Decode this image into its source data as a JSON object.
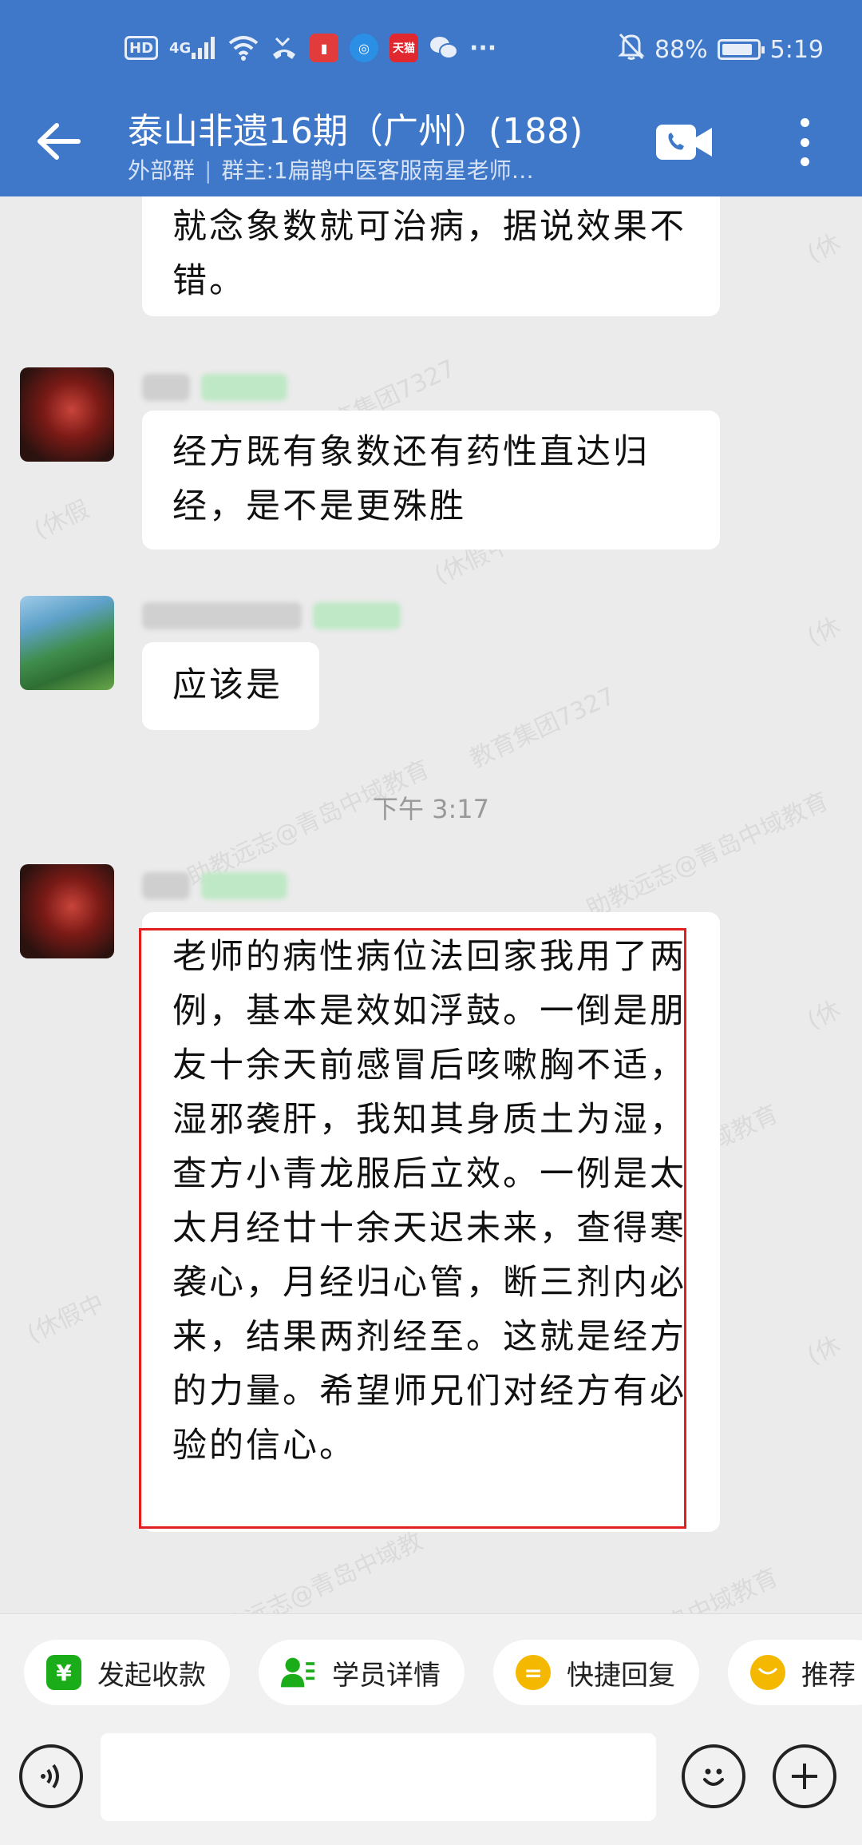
{
  "status_bar": {
    "network_label": "HD",
    "signal_label": "4G",
    "battery_percent": "88%",
    "battery_level": 0.88,
    "time": "5:19",
    "more_dots": "···"
  },
  "header": {
    "title": "泰山非遗16期（广州）(188)",
    "group_type": "外部群",
    "owner": "群主:1扁鹊中医客服南星老师…"
  },
  "messages": [
    {
      "text": "就念象数就可治病，据说效果不错。"
    },
    {
      "text": "经方既有象数还有药性直达归经，是不是更殊胜"
    },
    {
      "text": "应该是"
    },
    {
      "text": "老师的病性病位法回家我用了两例，基本是效如浮鼓。一倒是朋友十余天前感冒后咳嗽胸不适，湿邪袭肝，我知其身质土为湿，查方小青龙服后立效。一例是太太月经廿十余天迟未来，查得寒袭心，月经归心管，断三剂内必来，结果两剂经至。这就是经方的力量。希望师兄们对经方有必验的信心。"
    }
  ],
  "time_divider": "下午 3:17",
  "quick_actions": [
    {
      "label": "发起收款",
      "icon": "¥",
      "color": "#1aad19"
    },
    {
      "label": "学员详情",
      "icon": "person",
      "color": "#1aad19"
    },
    {
      "label": "快捷回复",
      "icon": "=",
      "color": "#f5b800"
    },
    {
      "label": "推荐",
      "icon": "smile",
      "color": "#f5b800"
    }
  ],
  "input": {
    "value": "",
    "placeholder": ""
  },
  "colors": {
    "header_bg": "#3f78c9",
    "chat_bg": "#ebebeb",
    "highlight_border": "#e02020"
  }
}
